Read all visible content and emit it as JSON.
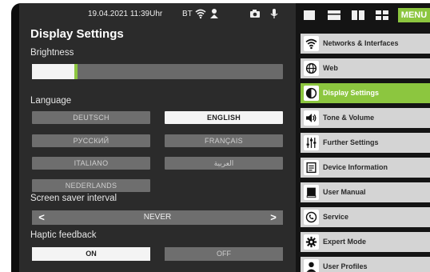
{
  "status": {
    "datetime": "19.04.2021 11:39Uhr",
    "bt": "BT",
    "icons": [
      "wifi-icon",
      "recycle-icon",
      "camera-icon",
      "microphone-icon"
    ]
  },
  "page": {
    "title": "Display Settings",
    "brightness_label": "Brightness",
    "brightness_level_percent": 17,
    "language_label": "Language",
    "languages": [
      "DEUTSCH",
      "ENGLISH",
      "РУССКИЙ",
      "FRANÇAIS",
      "ITALIANO",
      "العربية",
      "NEDERLANDS"
    ],
    "selected_language": "ENGLISH",
    "screensaver_label": "Screen saver interval",
    "screensaver_value": "NEVER",
    "screensaver_prev": "<",
    "screensaver_next": ">",
    "haptic_label": "Haptic feedback",
    "haptic_on": "ON",
    "haptic_off": "OFF",
    "haptic_selected": "ON"
  },
  "menu": {
    "label": "MENU",
    "view_icons": [
      "fullscreen-icon",
      "single-row-icon",
      "two-column-icon",
      "grid-icon"
    ],
    "items": [
      {
        "label": "Networks & Interfaces",
        "icon": "wifi-icon"
      },
      {
        "label": "Web",
        "icon": "globe-icon"
      },
      {
        "label": "Display Settings",
        "icon": "contrast-icon",
        "active": true
      },
      {
        "label": "Tone & Volume",
        "icon": "speaker-icon"
      },
      {
        "label": "Further Settings",
        "icon": "sliders-icon"
      },
      {
        "label": "Device Information",
        "icon": "info-document-icon"
      },
      {
        "label": "User Manual",
        "icon": "book-icon"
      },
      {
        "label": "Service",
        "icon": "phone-icon"
      },
      {
        "label": "Expert Mode",
        "icon": "gear-icon"
      },
      {
        "label": "User Profiles",
        "icon": "user-icon"
      }
    ]
  },
  "colors": {
    "accent": "#8cc63f",
    "panel": "#2b2b2b",
    "button": "#6e6e6e"
  }
}
